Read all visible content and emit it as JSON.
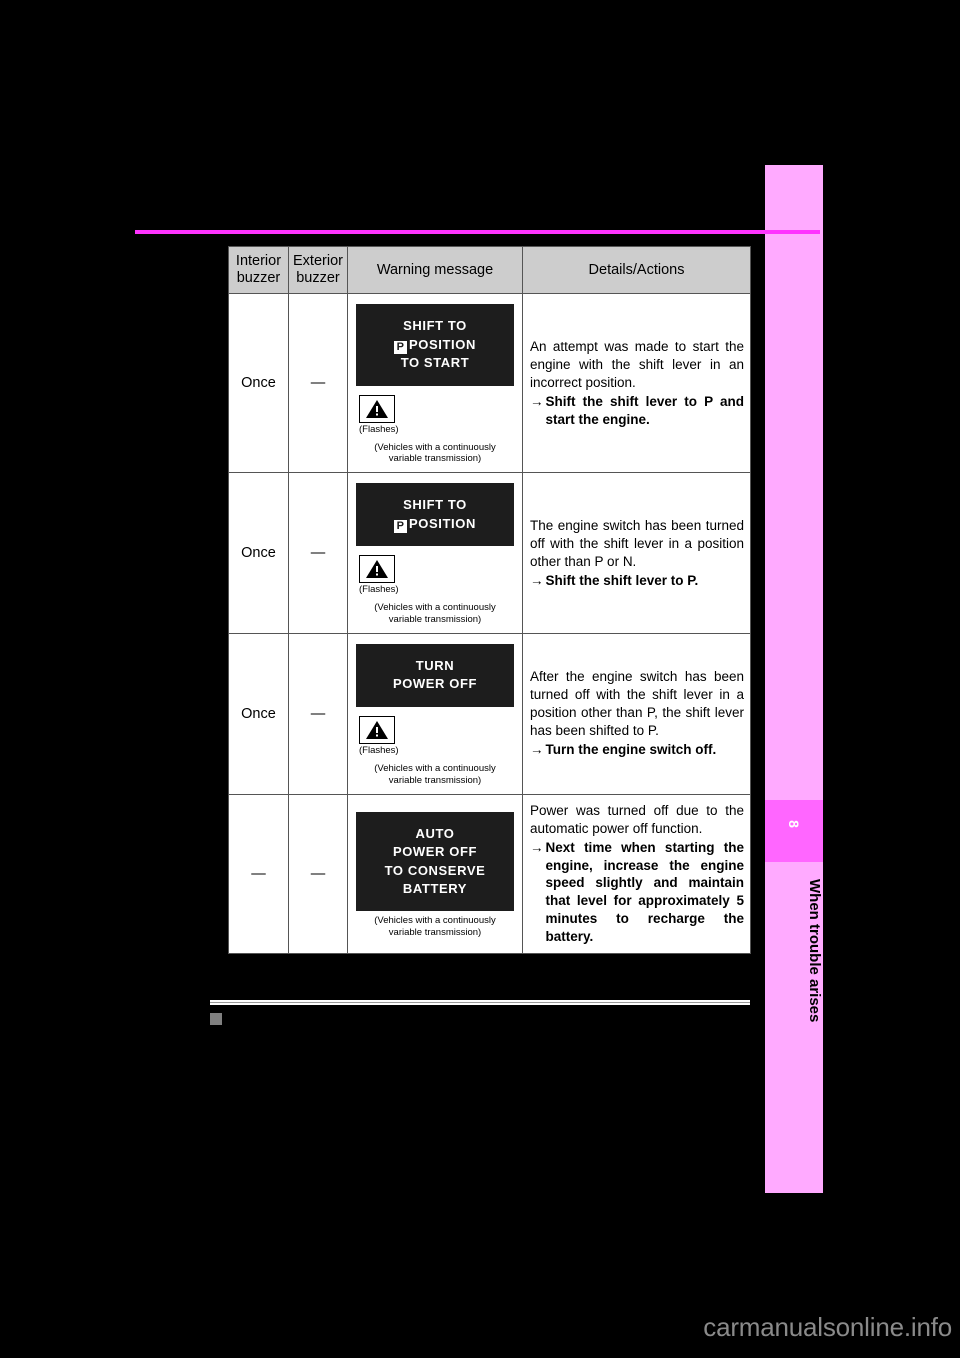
{
  "sidebar": {
    "chapter_number": "8",
    "chapter_title": "When trouble arises"
  },
  "table": {
    "headers": {
      "interior_buzzer": "Interior buzzer",
      "exterior_buzzer": "Exterior buzzer",
      "warning_message": "Warning message",
      "details_actions": "Details/Actions"
    },
    "rows": [
      {
        "interior_buzzer": "Once",
        "exterior_buzzer": "—",
        "display": {
          "line1": "SHIFT TO",
          "line2_pre": "P",
          "line2": "POSITION",
          "line3": "TO START"
        },
        "flashes_label": "(Flashes)",
        "vehicle_note": "(Vehicles with a continuously variable transmission)",
        "details": "An attempt was made to start the engine with the shift lever in an incorrect position.",
        "action_arrow": "→",
        "action": "Shift the shift lever to P and start the engine."
      },
      {
        "interior_buzzer": "Once",
        "exterior_buzzer": "—",
        "display": {
          "line1": "SHIFT TO",
          "line2_pre": "P",
          "line2": "POSITION",
          "line3": ""
        },
        "flashes_label": "(Flashes)",
        "vehicle_note": "(Vehicles with a continuously variable transmission)",
        "details": "The engine switch has been turned off with the shift lever in a position other than P or N.",
        "action_arrow": "→",
        "action": "Shift the shift lever to P."
      },
      {
        "interior_buzzer": "Once",
        "exterior_buzzer": "—",
        "display": {
          "line1": "TURN",
          "line2_pre": "",
          "line2": "POWER OFF",
          "line3": ""
        },
        "flashes_label": "(Flashes)",
        "vehicle_note": "(Vehicles with a continuously variable transmission)",
        "details": "After the engine switch has been turned off with the shift lever in a position other than P, the shift lever has been shifted to P.",
        "action_arrow": "→",
        "action": "Turn the engine switch off."
      },
      {
        "interior_buzzer": "—",
        "exterior_buzzer": "—",
        "display": {
          "line1": "AUTO",
          "line2_pre": "",
          "line2": "POWER OFF",
          "line3": "TO CONSERVE",
          "line4": "BATTERY"
        },
        "flashes_label": "",
        "vehicle_note": "(Vehicles with a continuously variable transmission)",
        "details": "Power was turned off due to the automatic power off function.",
        "action_arrow": "→",
        "action": "Next time when starting the engine, increase the engine speed slightly and maintain that level for approximately 5 minutes to recharge the battery."
      }
    ]
  },
  "watermark": "carmanualsonline.info",
  "colors": {
    "sidebar_bg": "#FFAAFF",
    "badge_bg": "#FF66FF",
    "rule": "#FF33FF",
    "page_bg": "#000000",
    "header_bg": "#CDCDCD",
    "lcd_bg": "#1D1D1D"
  }
}
